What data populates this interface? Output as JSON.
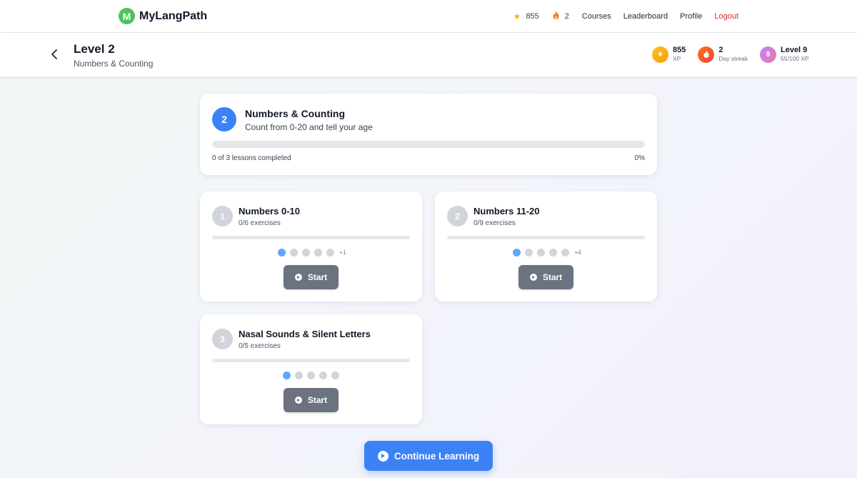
{
  "nav": {
    "brand_letter": "M",
    "brand_name": "MyLangPath",
    "xp": "855",
    "streak": "2",
    "links": [
      "Courses",
      "Leaderboard",
      "Profile"
    ],
    "logout": "Logout"
  },
  "level": {
    "title": "Level 2",
    "subtitle": "Numbers & Counting",
    "stats": {
      "xp_value": "855",
      "xp_label": "XP",
      "streak_value": "2",
      "streak_label": "Day streak",
      "level_badge": "9",
      "level_value": "Level 9",
      "level_progress": "55/100 XP"
    }
  },
  "summary": {
    "number": "2",
    "title": "Numbers & Counting",
    "description": "Count from 0-20 and tell your age",
    "progress_fraction": 0,
    "completed_text": "0 of 3 lessons completed",
    "percent_text": "0%"
  },
  "lessons": [
    {
      "number": "1",
      "title": "Numbers 0-10",
      "exercises": "0/6 exercises",
      "progress_fraction": 0,
      "dots_shown": 5,
      "active_dot": 0,
      "more": "+1",
      "button": "Start"
    },
    {
      "number": "2",
      "title": "Numbers 11-20",
      "exercises": "0/9 exercises",
      "progress_fraction": 0,
      "dots_shown": 5,
      "active_dot": 0,
      "more": "+4",
      "button": "Start"
    },
    {
      "number": "3",
      "title": "Nasal Sounds & Silent Letters",
      "exercises": "0/5 exercises",
      "progress_fraction": 0,
      "dots_shown": 5,
      "active_dot": 0,
      "more": "",
      "button": "Start"
    }
  ],
  "continue_label": "Continue Learning",
  "colors": {
    "primary": "#3b82f6",
    "brand": "#4cc35a",
    "logout": "#dc2626",
    "start_button": "#6b7280"
  }
}
